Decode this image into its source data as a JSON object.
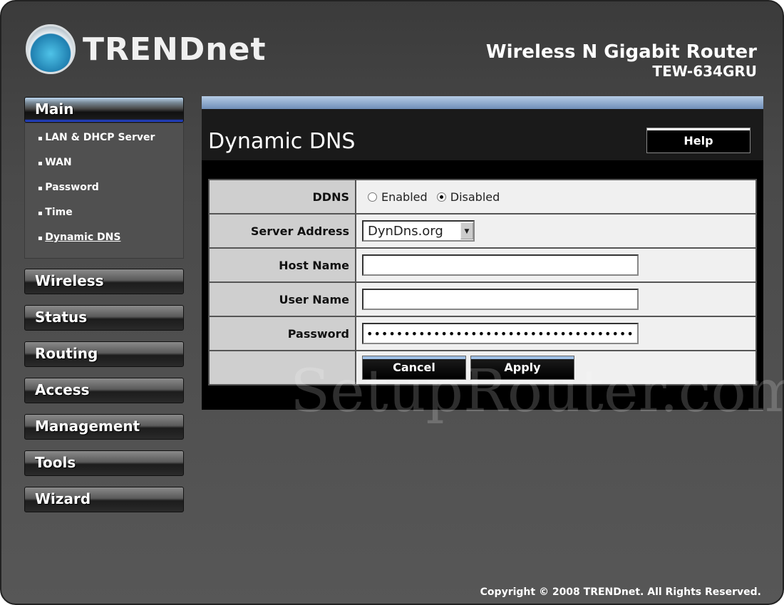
{
  "brand": {
    "logo_text": "TRENDnet",
    "product": "Wireless N Gigabit Router",
    "model": "TEW-634GRU"
  },
  "sidebar": {
    "main": "Main",
    "sub": [
      "LAN & DHCP Server",
      "WAN",
      "Password",
      "Time",
      "Dynamic DNS"
    ],
    "active_sub": "Dynamic DNS",
    "sections": [
      "Wireless",
      "Status",
      "Routing",
      "Access",
      "Management",
      "Tools",
      "Wizard"
    ]
  },
  "page": {
    "title": "Dynamic DNS",
    "help": "Help"
  },
  "form": {
    "ddns_label": "DDNS",
    "enabled": "Enabled",
    "disabled": "Disabled",
    "ddns_value": "Disabled",
    "server_label": "Server Address",
    "server_value": "DynDns.org",
    "host_label": "Host Name",
    "host_value": "",
    "user_label": "User Name",
    "user_value": "",
    "password_label": "Password",
    "password_value": "••••••••••••••••••••••••••••••••••••",
    "cancel": "Cancel",
    "apply": "Apply"
  },
  "watermark": "SetupRouter.com",
  "footer": "Copyright © 2008 TRENDnet. All Rights Reserved."
}
